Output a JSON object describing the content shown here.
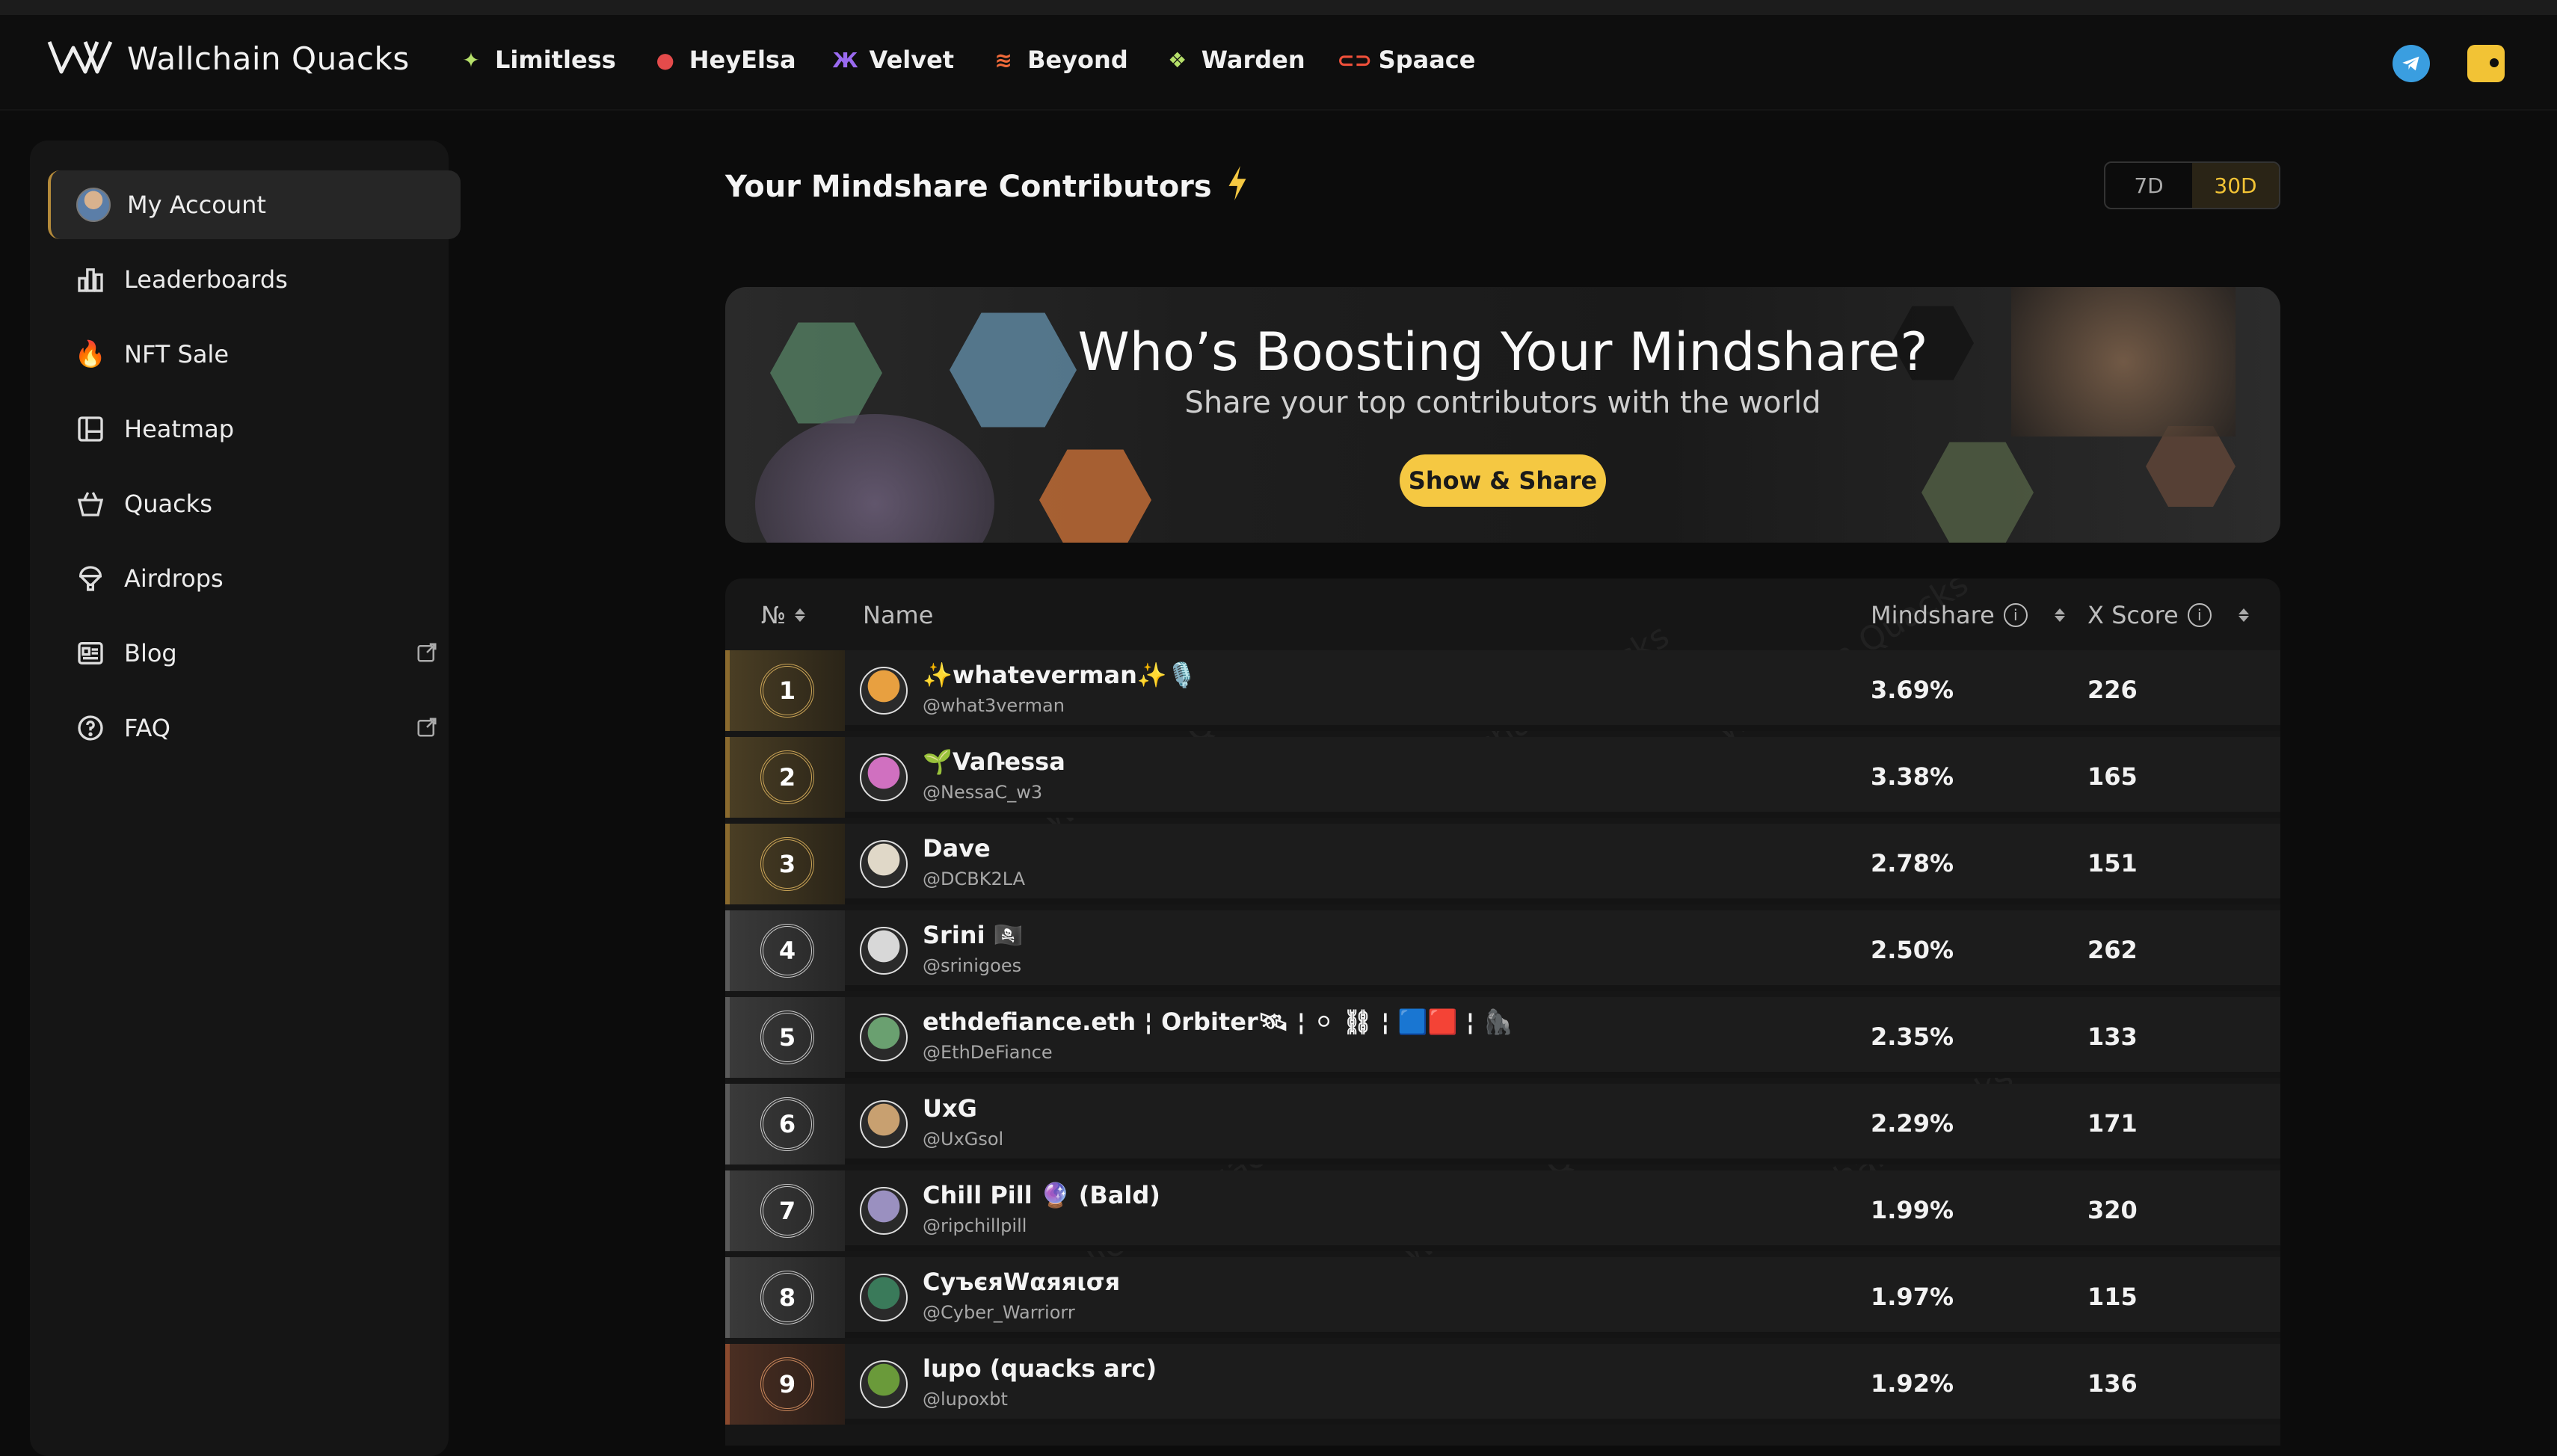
{
  "brand": {
    "name": "Wallchain Quacks"
  },
  "partners": [
    {
      "label": "Limitless",
      "icon": "sparkle-icon",
      "color": "#b6e06a"
    },
    {
      "label": "HeyElsa",
      "icon": "elsa-icon",
      "color": "#e44b4b"
    },
    {
      "label": "Velvet",
      "icon": "velvet-icon",
      "color": "#9a6af0"
    },
    {
      "label": "Beyond",
      "icon": "beyond-icon",
      "color": "#f06a3a"
    },
    {
      "label": "Warden",
      "icon": "warden-icon",
      "color": "#b6e06a"
    },
    {
      "label": "Spaace",
      "icon": "spaace-icon",
      "color": "#f0503a"
    }
  ],
  "sidebar": {
    "items": [
      {
        "label": "My Account",
        "icon": "avatar-icon"
      },
      {
        "label": "Leaderboards",
        "icon": "bar-chart-icon"
      },
      {
        "label": "NFT Sale",
        "icon": "fire-icon"
      },
      {
        "label": "Heatmap",
        "icon": "layout-icon"
      },
      {
        "label": "Quacks",
        "icon": "basket-icon"
      },
      {
        "label": "Airdrops",
        "icon": "balloon-icon"
      },
      {
        "label": "Blog",
        "icon": "news-icon"
      },
      {
        "label": "FAQ",
        "icon": "question-icon"
      }
    ]
  },
  "main": {
    "title": "Your Mindshare Contributors",
    "range_options": [
      "7D",
      "30D"
    ],
    "range_selected": "30D"
  },
  "banner": {
    "title": "Who’s Boosting Your Mindshare?",
    "subtitle": "Share your top contributors with the world",
    "button": "Show & Share"
  },
  "table": {
    "headers": {
      "rank": "№",
      "name": "Name",
      "mindshare": "Mindshare",
      "xscore": "X Score"
    },
    "rows": [
      {
        "rank": "1",
        "name": "✨whateverman✨🎙️",
        "handle": "@what3verman",
        "mindshare": "3.69%",
        "xscore": "226",
        "tier": "gold",
        "avatar_color": "#e8a040"
      },
      {
        "rank": "2",
        "name": "🌱VaՌessa",
        "handle": "@NessaC_w3",
        "mindshare": "3.38%",
        "xscore": "165",
        "tier": "gold",
        "avatar_color": "#d070c0"
      },
      {
        "rank": "3",
        "name": "Dave",
        "handle": "@DCBK2LA",
        "mindshare": "2.78%",
        "xscore": "151",
        "tier": "gold",
        "avatar_color": "#e0d8c8"
      },
      {
        "rank": "4",
        "name": "Srini 🏴‍☠️",
        "handle": "@srinigoes",
        "mindshare": "2.50%",
        "xscore": "262",
        "tier": "silver",
        "avatar_color": "#d8d8d8"
      },
      {
        "rank": "5",
        "name": "ethdefiance.eth ¦ Orbiter🛰 ¦ ⚪ ⛓ ¦ 🟦🟥 ¦ 🦍",
        "handle": "@EthDeFiance",
        "mindshare": "2.35%",
        "xscore": "133",
        "tier": "silver",
        "avatar_color": "#6aa070"
      },
      {
        "rank": "6",
        "name": "UxG",
        "handle": "@UxGsol",
        "mindshare": "2.29%",
        "xscore": "171",
        "tier": "silver",
        "avatar_color": "#c8a070"
      },
      {
        "rank": "7",
        "name": "Chill Pill 🔮 (Bald)",
        "handle": "@ripchillpill",
        "mindshare": "1.99%",
        "xscore": "320",
        "tier": "silver",
        "avatar_color": "#9a90c0"
      },
      {
        "rank": "8",
        "name": "СуъєяWαяяισя",
        "handle": "@Cyber_Warriorr",
        "mindshare": "1.97%",
        "xscore": "115",
        "tier": "silver",
        "avatar_color": "#3a7a5a"
      },
      {
        "rank": "9",
        "name": "lupo (quacks arc)",
        "handle": "@lupoxbt",
        "mindshare": "1.92%",
        "xscore": "136",
        "tier": "bronze",
        "avatar_color": "#6a9a3a"
      }
    ]
  },
  "watermark": "Wallchain Quacks"
}
